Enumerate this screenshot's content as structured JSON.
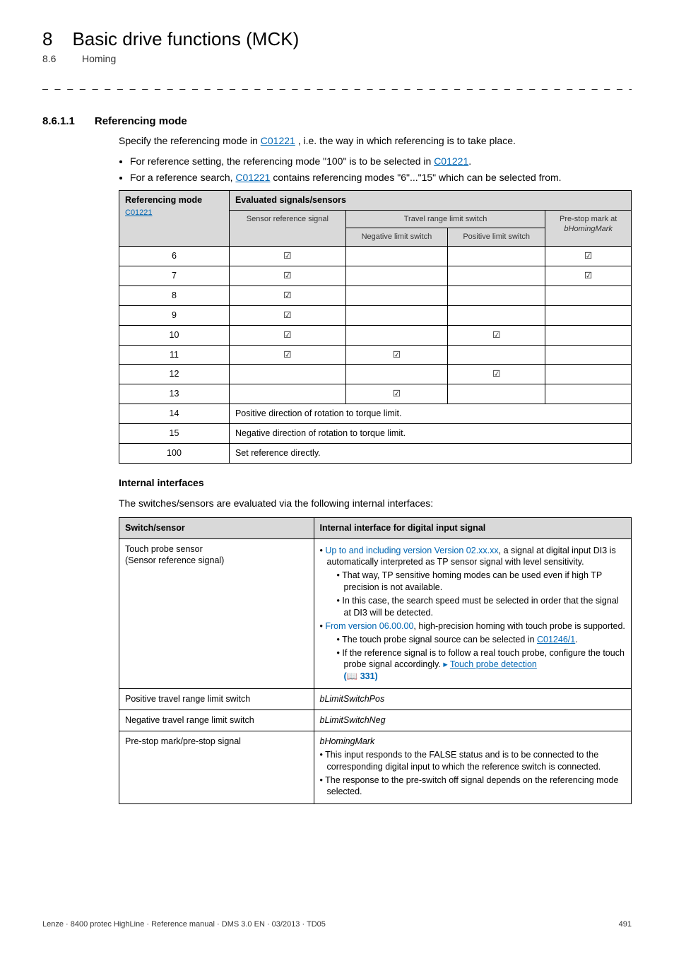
{
  "header": {
    "chapter_num": "8",
    "chapter_title": "Basic drive functions (MCK)",
    "section_num": "8.6",
    "section_title": "Homing"
  },
  "section": {
    "num": "8.6.1.1",
    "title": "Referencing mode"
  },
  "intro": {
    "p1a": "Specify the referencing mode in ",
    "p1_link": "C01221",
    "p1b": " , i.e. the way in which referencing is to take place.",
    "b1a": "For reference setting, the referencing mode \"100\" is to be selected in ",
    "b1_link": "C01221",
    "b1b": ".",
    "b2a": "For a reference search, ",
    "b2_link": "C01221",
    "b2b": " contains referencing modes \"6\"...\"15\" which can be selected from."
  },
  "table1": {
    "h_mode": "Referencing mode",
    "h_mode_link": "C01221",
    "h_eval": "Evaluated signals/sensors",
    "h_sensor": "Sensor reference signal",
    "h_travel": "Travel range limit switch",
    "h_neg": "Negative limit switch",
    "h_pos": "Positive limit switch",
    "h_pre": "Pre-stop mark at",
    "h_pre_it": "bHomingMark",
    "rows": [
      {
        "mode": "6",
        "sensor": "☑",
        "neg": "",
        "pos": "",
        "pre": "☑"
      },
      {
        "mode": "7",
        "sensor": "☑",
        "neg": "",
        "pos": "",
        "pre": "☑"
      },
      {
        "mode": "8",
        "sensor": "☑",
        "neg": "",
        "pos": "",
        "pre": ""
      },
      {
        "mode": "9",
        "sensor": "☑",
        "neg": "",
        "pos": "",
        "pre": ""
      },
      {
        "mode": "10",
        "sensor": "☑",
        "neg": "",
        "pos": "☑",
        "pre": ""
      },
      {
        "mode": "11",
        "sensor": "☑",
        "neg": "☑",
        "pos": "",
        "pre": ""
      },
      {
        "mode": "12",
        "sensor": "",
        "neg": "",
        "pos": "☑",
        "pre": ""
      },
      {
        "mode": "13",
        "sensor": "",
        "neg": "☑",
        "pos": "",
        "pre": ""
      }
    ],
    "r14_mode": "14",
    "r14_text": "Positive direction of rotation to torque limit.",
    "r15_mode": "15",
    "r15_text": "Negative direction of rotation to torque limit.",
    "r100_mode": "100",
    "r100_text": "Set reference directly."
  },
  "internal": {
    "heading": "Internal interfaces",
    "p": "The switches/sensors are evaluated via the following internal interfaces:"
  },
  "table2": {
    "h1": "Switch/sensor",
    "h2": "Internal interface for digital input signal",
    "r1_c1a": "Touch probe sensor",
    "r1_c1b": "(Sensor reference signal)",
    "r1_b1_blue": "Up to and including version Version 02.xx.xx",
    "r1_b1_rest": ", a signal at digital input DI3 is automatically interpreted as TP sensor signal with level sensitivity.",
    "r1_b1_s1": "That way, TP sensitive homing modes can be used even if high TP precision is not available.",
    "r1_b1_s2": "In this case, the search speed must be selected in order that the signal at DI3 will be detected.",
    "r1_b2_blue": "From version 06.00.00",
    "r1_b2_rest": ", high-precision homing with touch probe is supported.",
    "r1_b2_s1a": "The touch probe signal source can be selected in ",
    "r1_b2_s1_link": "C01246/1",
    "r1_b2_s1b": ".",
    "r1_b2_s2a": "If the reference signal is to follow a real touch probe, configure the touch probe signal accordingly. ",
    "r1_b2_s2_tri": "▸",
    "r1_b2_s2_link": "Touch probe detection",
    "r1_b2_s2_page": "(📖 331)",
    "r2_c1": "Positive travel range limit switch",
    "r2_c2": "bLimitSwitchPos",
    "r3_c1": "Negative travel range limit switch",
    "r3_c2": "bLimitSwitchNeg",
    "r4_c1": "Pre-stop mark/pre-stop signal",
    "r4_c2_it": "bHomingMark",
    "r4_b1": "This input responds to the FALSE status and is to be connected to the corresponding digital input to which the reference switch is connected.",
    "r4_b2": "The response to the pre-switch off signal depends on the referencing mode selected."
  },
  "footer": {
    "left": "Lenze · 8400 protec HighLine · Reference manual · DMS 3.0 EN · 03/2013 · TD05",
    "right": "491"
  }
}
